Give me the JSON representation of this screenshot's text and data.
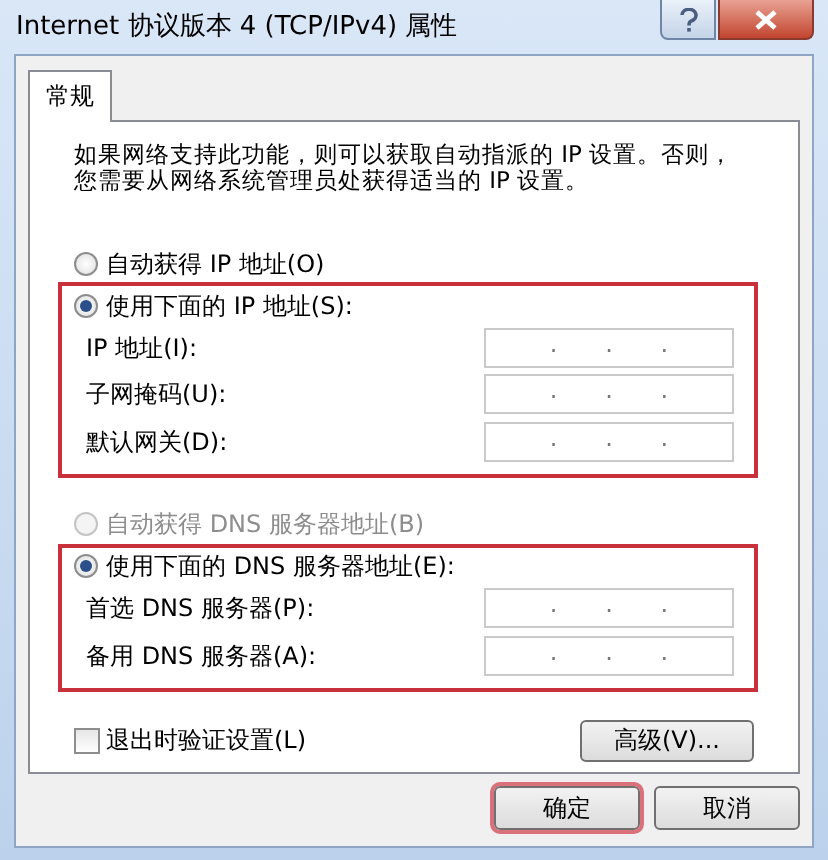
{
  "window": {
    "title": "Internet 协议版本 4 (TCP/IPv4) 属性"
  },
  "tabs": [
    {
      "label": "常规",
      "selected": true
    }
  ],
  "description": [
    "如果网络支持此功能，则可以获取自动指派的 IP 设置。否则，",
    "您需要从网络系统管理员处获得适当的 IP 设置。"
  ],
  "sections": [
    {
      "highlighted": true,
      "options": [
        {
          "label": "自动获得 IP 地址(O)",
          "selected": false,
          "disabled": false
        },
        {
          "label": "使用下面的 IP 地址(S):",
          "selected": true,
          "disabled": false
        }
      ],
      "fields": [
        {
          "label": "IP 地址(I):",
          "separator": "."
        },
        {
          "label": "子网掩码(U):",
          "separator": "."
        },
        {
          "label": "默认网关(D):",
          "separator": "."
        }
      ]
    },
    {
      "highlighted": true,
      "options": [
        {
          "label": "自动获得 DNS 服务器地址(B)",
          "selected": false,
          "disabled": true
        },
        {
          "label": "使用下面的 DNS 服务器地址(E):",
          "selected": true,
          "disabled": false
        }
      ],
      "fields": [
        {
          "label": "首选 DNS 服务器(P):",
          "separator": "."
        },
        {
          "label": "备用 DNS 服务器(A):",
          "separator": "."
        }
      ]
    }
  ],
  "validate_checkbox": {
    "label": "退出时验证设置(L)",
    "checked": false
  },
  "advanced_button": {
    "label": "高级(V)..."
  },
  "dialog_buttons": [
    {
      "label": "确定",
      "highlighted": true
    },
    {
      "label": "取消",
      "highlighted": false
    }
  ]
}
